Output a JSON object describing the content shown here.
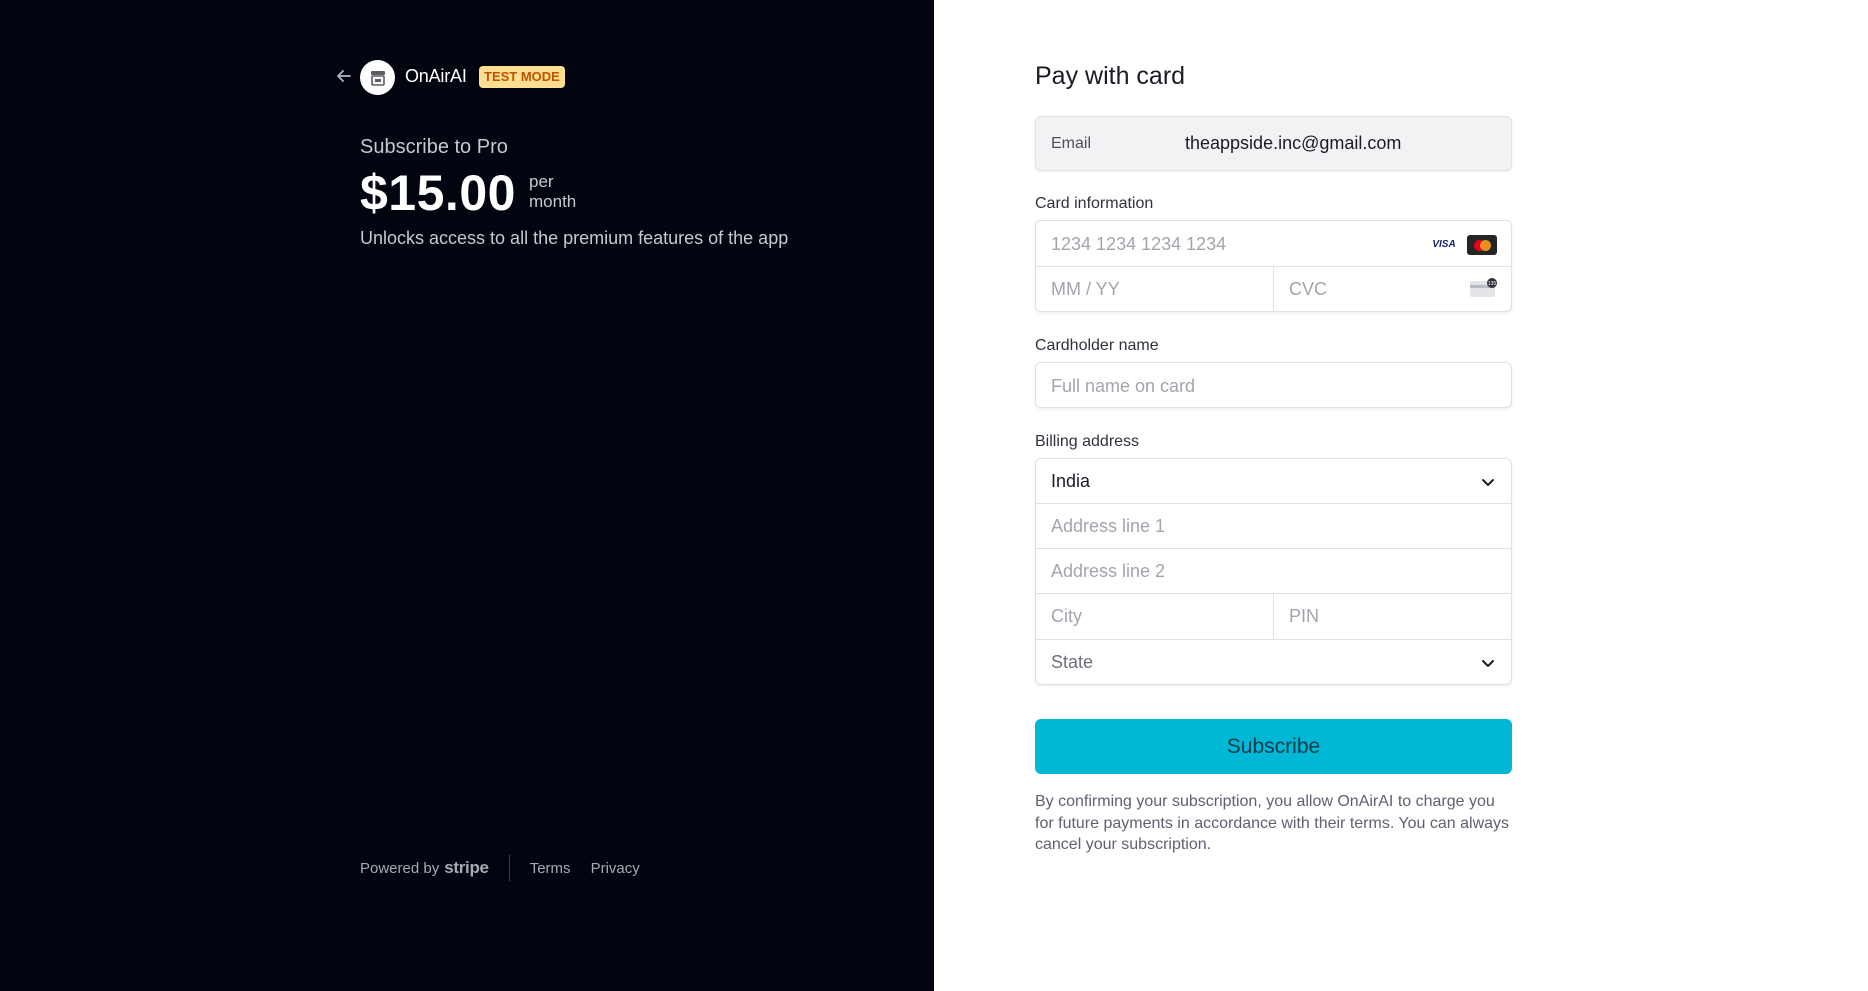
{
  "summary": {
    "merchant_name": "OnAirAI",
    "test_badge": "TEST MODE",
    "product_title": "Subscribe to Pro",
    "price": "$15.00",
    "interval_line1": "per",
    "interval_line2": "month",
    "description": "Unlocks access to all the premium features of the app"
  },
  "footer": {
    "powered_by": "Powered by",
    "stripe": "stripe",
    "terms": "Terms",
    "privacy": "Privacy"
  },
  "form": {
    "title": "Pay with card",
    "email_label": "Email",
    "email_value": "theappside.inc@gmail.com",
    "card_info_label": "Card information",
    "card_number_placeholder": "1234 1234 1234 1234",
    "expiry_placeholder": "MM / YY",
    "cvc_placeholder": "CVC",
    "cvc_icon_text": "135",
    "visa_text": "VISA",
    "cardholder_label": "Cardholder name",
    "cardholder_placeholder": "Full name on card",
    "billing_label": "Billing address",
    "country": "India",
    "address1_placeholder": "Address line 1",
    "address2_placeholder": "Address line 2",
    "city_placeholder": "City",
    "pin_placeholder": "PIN",
    "state_placeholder": "State",
    "subscribe_label": "Subscribe",
    "terms_text": "By confirming your subscription, you allow OnAirAI to charge you for future payments in accordance with their terms. You can always cancel your subscription."
  },
  "colors": {
    "left_bg": "#02040f",
    "accent_button": "#00b8d6",
    "badge_bg": "#ffde92",
    "badge_text": "#bb5504"
  },
  "icons": [
    "back-arrow-icon",
    "store-icon",
    "visa-icon",
    "mastercard-icon",
    "cvc-card-icon",
    "chevron-down-icon"
  ]
}
